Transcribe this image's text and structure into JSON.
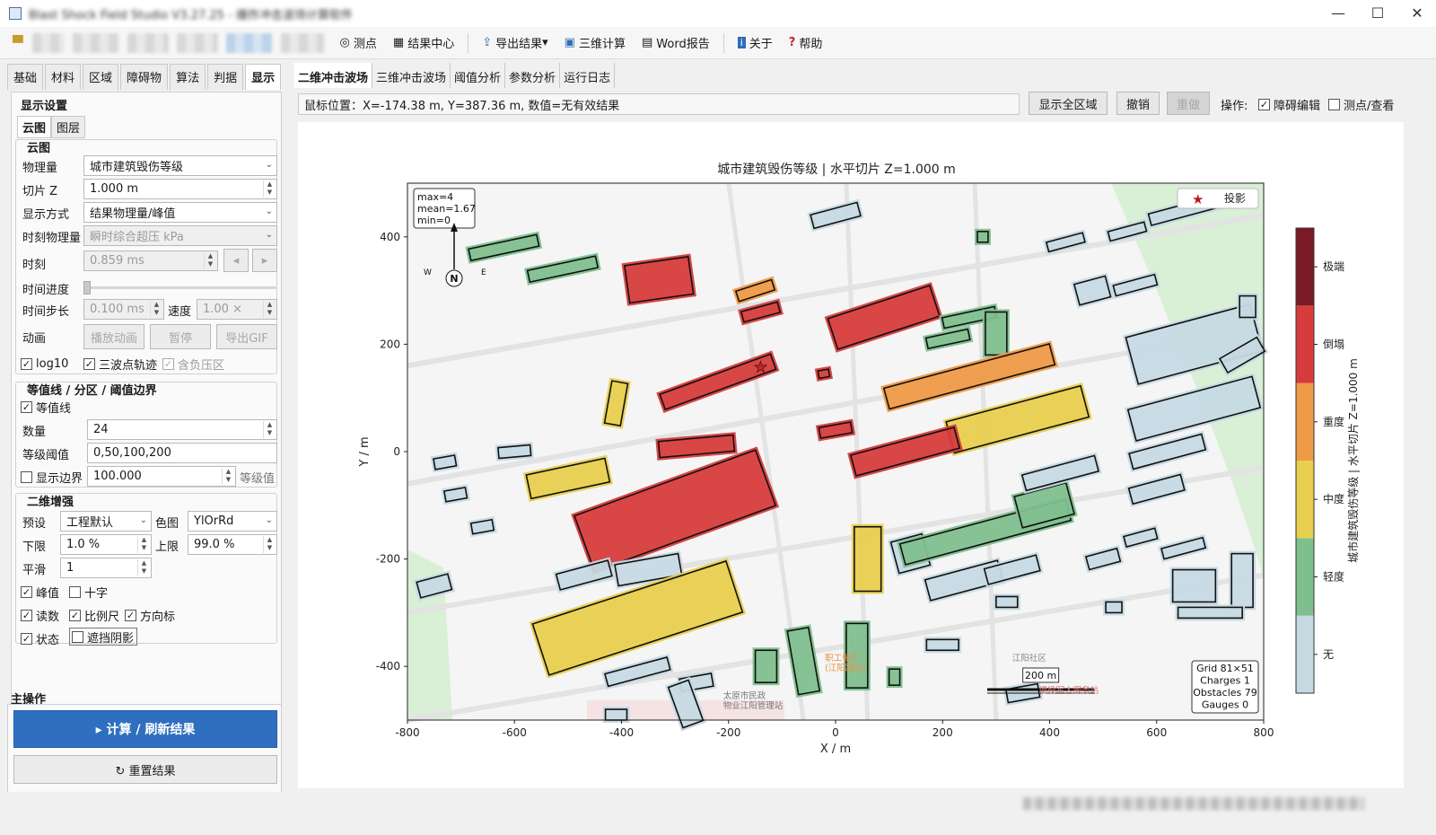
{
  "window": {
    "title": "Blast Shock Field Studio V3.27.25 - 爆炸冲击波场计算软件",
    "minimize": "—",
    "maximize": "☐",
    "close": "✕"
  },
  "toolbar": {
    "measure": "测点",
    "results": "结果中心",
    "export": "导出结果",
    "export_arrow": "▾",
    "calc3d": "三维计算",
    "word": "Word报告",
    "about": "关于",
    "help": "帮助"
  },
  "left_tabs": [
    "基础",
    "材料",
    "区域",
    "障碍物",
    "算法",
    "判据",
    "显示"
  ],
  "display_settings": {
    "title": "显示设置",
    "subtabs": [
      "云图",
      "图层"
    ],
    "cloud_title": "云图",
    "quantity_label": "物理量",
    "quantity_value": "城市建筑毁伤等级",
    "slice_label": "切片 Z",
    "slice_value": "1.000 m",
    "mode_label": "显示方式",
    "mode_value": "结果物理量/峰值",
    "time_quantity_label": "时刻物理量",
    "time_quantity_value": "瞬时综合超压 kPa",
    "time_label": "时刻",
    "time_value": "0.859 ms",
    "time_prev": "◂",
    "time_next": "▸",
    "progress_label": "时间进度",
    "progress_value": 0.0,
    "step_label": "时间步长",
    "step_value": "0.100 ms",
    "speed_label": "速度",
    "speed_value": "1.00 ×",
    "anim_label": "动画",
    "play": "播放动画",
    "pause": "暂停",
    "gif": "导出GIF",
    "log10": "log10",
    "wave_track": "三波点轨迹",
    "neg_zone": "含负压区"
  },
  "contour": {
    "title": "等值线 / 分区 / 阈值边界",
    "enable": "等值线",
    "count_label": "数量",
    "count_value": "24",
    "threshold_label": "等级阈值",
    "threshold_value": "0,50,100,200",
    "boundary_label": "显示边界",
    "boundary_value": "100.000",
    "boundary_unit": "等级值"
  },
  "enhance": {
    "title": "二维增强",
    "preset_label": "预设",
    "preset_value": "工程默认",
    "cmap_label": "色图",
    "cmap_value": "YlOrRd",
    "lower_label": "下限",
    "lower_value": "1.0 %",
    "upper_label": "上限",
    "upper_value": "99.0 %",
    "smooth_label": "平滑",
    "smooth_value": "1",
    "peak": "峰值",
    "cross": "十字",
    "readout": "读数",
    "scale": "比例尺",
    "compass": "方向标",
    "status": "状态",
    "shadow": "遮挡阴影"
  },
  "main_ops": {
    "title": "主操作",
    "compute": "▸  计算 / 刷新结果",
    "reset": "↻ 重置结果"
  },
  "right_tabs": [
    "二维冲击波场",
    "三维冲击波场",
    "阈值分析",
    "参数分析",
    "运行日志"
  ],
  "infobar": {
    "text": "鼠标位置：X=-174.38 m, Y=387.36 m, 数值=无有效结果"
  },
  "actions": {
    "show_all": "显示全区域",
    "undo": "撤销",
    "redo": "重做",
    "ops_label": "操作:",
    "obstacle_edit": "障碍编辑",
    "measure_view": "测点/查看"
  },
  "chart_data": {
    "type": "heatmap",
    "title": "城市建筑毁伤等级 | 水平切片 Z=1.000 m",
    "xlabel": "X / m",
    "ylabel": "Y / m",
    "xlim": [
      -800,
      800
    ],
    "ylim": [
      -500,
      500
    ],
    "xticks": [
      "-800",
      "-600",
      "-400",
      "-200",
      "0",
      "200",
      "400",
      "600",
      "800"
    ],
    "yticks": [
      "-400",
      "-200",
      "0",
      "200",
      "400"
    ],
    "colorbar_label": "城市建筑毁伤等级 | 水平切片 Z=1.000 m",
    "colorbar_levels": [
      "无",
      "轻度",
      "中度",
      "重度",
      "倒塌",
      "极端"
    ],
    "colorbar_colors": [
      "#c6d9e3",
      "#7fbf8e",
      "#e8cf4f",
      "#ee9a46",
      "#d63c3c",
      "#7a1a24"
    ],
    "stats_box": [
      "max=4",
      "mean=1.67",
      "min=0"
    ],
    "legend_projection": "投影",
    "scale_label": "200 m",
    "info_box": [
      "Grid 81×51",
      "Charges 1",
      "Obstacles 79",
      "Gauges 0"
    ],
    "compass": {
      "n": "N",
      "w": "W",
      "e": "E"
    },
    "charge": {
      "x": -140,
      "y": 158
    },
    "map_labels": [
      "职工餐厅\n(江阳路店)",
      "太原市民政\n物业江阳管理站",
      "江阳社区",
      "退役军人服务站"
    ],
    "buildings": [
      {
        "x": -620,
        "y": 380,
        "w": 130,
        "h": 22,
        "a": 12,
        "lvl": 1
      },
      {
        "x": -510,
        "y": 340,
        "w": 130,
        "h": 22,
        "a": 12,
        "lvl": 1
      },
      {
        "x": -330,
        "y": 320,
        "w": 120,
        "h": 70,
        "a": 8,
        "lvl": 4
      },
      {
        "x": -150,
        "y": 300,
        "w": 70,
        "h": 20,
        "a": 18,
        "lvl": 3
      },
      {
        "x": -140,
        "y": 260,
        "w": 70,
        "h": 20,
        "a": 15,
        "lvl": 4
      },
      {
        "x": 0,
        "y": 440,
        "w": 90,
        "h": 26,
        "a": 15,
        "lvl": 0
      },
      {
        "x": 275,
        "y": 400,
        "w": 20,
        "h": 20,
        "a": 0,
        "lvl": 1
      },
      {
        "x": 430,
        "y": 390,
        "w": 70,
        "h": 18,
        "a": 15,
        "lvl": 0
      },
      {
        "x": 545,
        "y": 410,
        "w": 70,
        "h": 18,
        "a": 15,
        "lvl": 0
      },
      {
        "x": 655,
        "y": 450,
        "w": 140,
        "h": 22,
        "a": 15,
        "lvl": 0
      },
      {
        "x": 90,
        "y": 250,
        "w": 200,
        "h": 60,
        "a": 18,
        "lvl": 4
      },
      {
        "x": 250,
        "y": 250,
        "w": 100,
        "h": 20,
        "a": 12,
        "lvl": 1
      },
      {
        "x": 210,
        "y": 210,
        "w": 80,
        "h": 20,
        "a": 12,
        "lvl": 1
      },
      {
        "x": 300,
        "y": 220,
        "w": 40,
        "h": 80,
        "a": 0,
        "lvl": 1
      },
      {
        "x": 480,
        "y": 300,
        "w": 60,
        "h": 40,
        "a": 15,
        "lvl": 0
      },
      {
        "x": 560,
        "y": 310,
        "w": 80,
        "h": 20,
        "a": 15,
        "lvl": 0
      },
      {
        "x": 670,
        "y": 200,
        "w": 240,
        "h": 90,
        "a": 15,
        "lvl": 0
      },
      {
        "x": 770,
        "y": 270,
        "w": 30,
        "h": 40,
        "a": 0,
        "lvl": 0
      },
      {
        "x": 760,
        "y": 180,
        "w": 80,
        "h": 30,
        "a": 30,
        "lvl": 0
      },
      {
        "x": 670,
        "y": 80,
        "w": 240,
        "h": 60,
        "a": 15,
        "lvl": 0
      },
      {
        "x": 250,
        "y": 140,
        "w": 320,
        "h": 40,
        "a": 15,
        "lvl": 3
      },
      {
        "x": 340,
        "y": 60,
        "w": 260,
        "h": 60,
        "a": 15,
        "lvl": 2
      },
      {
        "x": -410,
        "y": 90,
        "w": 80,
        "h": 30,
        "a": 80,
        "lvl": 2
      },
      {
        "x": -220,
        "y": 130,
        "w": 220,
        "h": 30,
        "a": 20,
        "lvl": 4
      },
      {
        "x": -22,
        "y": 145,
        "w": 20,
        "h": 14,
        "a": 10,
        "lvl": 4
      },
      {
        "x": -260,
        "y": 10,
        "w": 140,
        "h": 30,
        "a": 5,
        "lvl": 4
      },
      {
        "x": -300,
        "y": -110,
        "w": 360,
        "h": 110,
        "a": 20,
        "lvl": 4
      },
      {
        "x": -500,
        "y": -50,
        "w": 150,
        "h": 45,
        "a": 12,
        "lvl": 2
      },
      {
        "x": -600,
        "y": 0,
        "w": 60,
        "h": 20,
        "a": 5,
        "lvl": 0
      },
      {
        "x": -730,
        "y": -20,
        "w": 40,
        "h": 20,
        "a": 10,
        "lvl": 0
      },
      {
        "x": -710,
        "y": -80,
        "w": 40,
        "h": 20,
        "a": 10,
        "lvl": 0
      },
      {
        "x": -660,
        "y": -140,
        "w": 40,
        "h": 20,
        "a": 10,
        "lvl": 0
      },
      {
        "x": 0,
        "y": 40,
        "w": 60,
        "h": 20,
        "a": 10,
        "lvl": 4
      },
      {
        "x": 130,
        "y": 0,
        "w": 200,
        "h": 40,
        "a": 15,
        "lvl": 4
      },
      {
        "x": -350,
        "y": -220,
        "w": 120,
        "h": 40,
        "a": 10,
        "lvl": 0
      },
      {
        "x": -470,
        "y": -230,
        "w": 100,
        "h": 30,
        "a": 15,
        "lvl": 0
      },
      {
        "x": -370,
        "y": -310,
        "w": 380,
        "h": 100,
        "a": 18,
        "lvl": 2
      },
      {
        "x": -750,
        "y": -250,
        "w": 60,
        "h": 30,
        "a": 15,
        "lvl": 0
      },
      {
        "x": -370,
        "y": -410,
        "w": 120,
        "h": 24,
        "a": 15,
        "lvl": 0
      },
      {
        "x": -260,
        "y": -430,
        "w": 60,
        "h": 24,
        "a": 10,
        "lvl": 0
      },
      {
        "x": -130,
        "y": -400,
        "w": 40,
        "h": 60,
        "a": 0,
        "lvl": 1
      },
      {
        "x": -60,
        "y": -390,
        "w": 40,
        "h": 120,
        "a": 10,
        "lvl": 1
      },
      {
        "x": -280,
        "y": -470,
        "w": 40,
        "h": 80,
        "a": 20,
        "lvl": 0
      },
      {
        "x": -410,
        "y": -490,
        "w": 40,
        "h": 20,
        "a": 0,
        "lvl": 0
      },
      {
        "x": 60,
        "y": -200,
        "w": 50,
        "h": 120,
        "a": 0,
        "lvl": 2
      },
      {
        "x": 140,
        "y": -190,
        "w": 60,
        "h": 60,
        "a": 15,
        "lvl": 0
      },
      {
        "x": 280,
        "y": -150,
        "w": 320,
        "h": 40,
        "a": 15,
        "lvl": 1
      },
      {
        "x": 390,
        "y": -100,
        "w": 100,
        "h": 60,
        "a": 15,
        "lvl": 1
      },
      {
        "x": 240,
        "y": -240,
        "w": 140,
        "h": 40,
        "a": 15,
        "lvl": 0
      },
      {
        "x": 330,
        "y": -220,
        "w": 100,
        "h": 30,
        "a": 15,
        "lvl": 0
      },
      {
        "x": 500,
        "y": -200,
        "w": 60,
        "h": 25,
        "a": 15,
        "lvl": 0
      },
      {
        "x": 570,
        "y": -160,
        "w": 60,
        "h": 20,
        "a": 15,
        "lvl": 0
      },
      {
        "x": 650,
        "y": -180,
        "w": 80,
        "h": 20,
        "a": 15,
        "lvl": 0
      },
      {
        "x": 600,
        "y": -70,
        "w": 100,
        "h": 30,
        "a": 15,
        "lvl": 0
      },
      {
        "x": 620,
        "y": 0,
        "w": 140,
        "h": 30,
        "a": 15,
        "lvl": 0
      },
      {
        "x": 420,
        "y": -40,
        "w": 140,
        "h": 30,
        "a": 15,
        "lvl": 0
      },
      {
        "x": 670,
        "y": -250,
        "w": 80,
        "h": 60,
        "a": 0,
        "lvl": 0
      },
      {
        "x": 760,
        "y": -240,
        "w": 40,
        "h": 100,
        "a": 0,
        "lvl": 0
      },
      {
        "x": 700,
        "y": -300,
        "w": 120,
        "h": 20,
        "a": 0,
        "lvl": 0
      },
      {
        "x": 520,
        "y": -290,
        "w": 30,
        "h": 20,
        "a": 0,
        "lvl": 0
      },
      {
        "x": 200,
        "y": -360,
        "w": 60,
        "h": 20,
        "a": 0,
        "lvl": 0
      },
      {
        "x": 320,
        "y": -280,
        "w": 40,
        "h": 20,
        "a": 0,
        "lvl": 0
      },
      {
        "x": 350,
        "y": -450,
        "w": 60,
        "h": 25,
        "a": 10,
        "lvl": 0
      },
      {
        "x": 40,
        "y": -380,
        "w": 40,
        "h": 120,
        "a": 0,
        "lvl": 1
      },
      {
        "x": 110,
        "y": -420,
        "w": 20,
        "h": 30,
        "a": 0,
        "lvl": 1
      }
    ],
    "units": {
      "x": "m",
      "y": "m"
    }
  }
}
